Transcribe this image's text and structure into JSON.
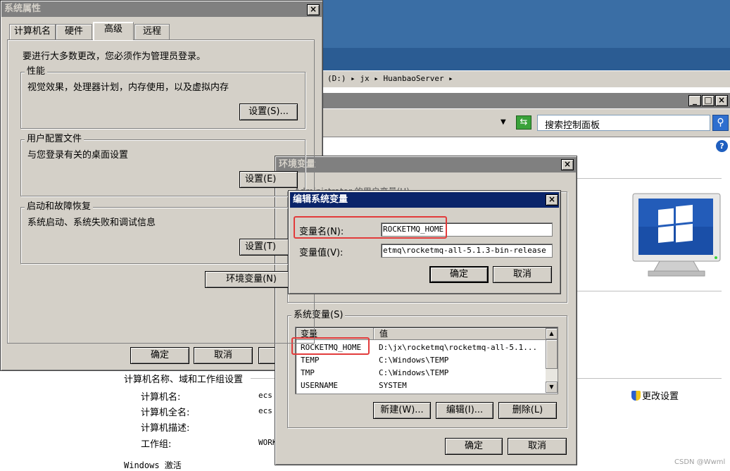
{
  "bg_window": {
    "address_path": "(D:) ▸ jx ▸ HuanbaoServer ▸",
    "search_placeholder": "搜索控制面板",
    "computer_section_title": "计算机名称、域和工作组设置",
    "rows": [
      {
        "label": "计算机名:",
        "value": "ecs"
      },
      {
        "label": "计算机全名:",
        "value": "ecs"
      },
      {
        "label": "计算机描述:",
        "value": ""
      },
      {
        "label": "工作组:",
        "value": "WORK"
      }
    ],
    "change_settings": "更改设置",
    "activation": "Windows 激活",
    "watermark": "CSDN @Wwml"
  },
  "sysprops": {
    "title": "系统属性",
    "tabs": [
      "计算机名",
      "硬件",
      "高级",
      "远程"
    ],
    "admin_note": "要进行大多数更改，您必须作为管理员登录。",
    "perf_title": "性能",
    "perf_desc": "视觉效果，处理器计划，内存使用，以及虚拟内存",
    "perf_button": "设置(S)...",
    "profile_title": "用户配置文件",
    "profile_desc": "与您登录有关的桌面设置",
    "profile_button": "设置(E)",
    "startup_title": "启动和故障恢复",
    "startup_desc": "系统启动、系统失败和调试信息",
    "startup_button": "设置(T)",
    "env_button": "环境变量(N)",
    "ok": "确定",
    "cancel": "取消",
    "apply": "应"
  },
  "envvars": {
    "title": "环境变量",
    "user_group_partial": "Administrator 的用户变量(U)",
    "sys_group_title": "系统变量(S)",
    "col_var": "变量",
    "col_val": "值",
    "rows": [
      {
        "name": "ROCKETMQ_HOME",
        "value": "D:\\jx\\rocketmq\\rocketmq-all-5.1..."
      },
      {
        "name": "TEMP",
        "value": "C:\\Windows\\TEMP"
      },
      {
        "name": "TMP",
        "value": "C:\\Windows\\TEMP"
      },
      {
        "name": "USERNAME",
        "value": "SYSTEM"
      }
    ],
    "new_btn": "新建(W)...",
    "edit_btn": "编辑(I)...",
    "delete_btn": "删除(L)",
    "ok": "确定",
    "cancel": "取消"
  },
  "editvar": {
    "title": "编辑系统变量",
    "name_label": "变量名(N):",
    "name_value": "ROCKETMQ_HOME",
    "value_label": "变量值(V):",
    "value_value": "etmq\\rocketmq-all-5.1.3-bin-release",
    "ok": "确定",
    "cancel": "取消"
  },
  "colors": {
    "titlebar_active": "#0a246a",
    "highlight_red": "#e23b3b",
    "bg_blue": "#3a6ea5"
  }
}
